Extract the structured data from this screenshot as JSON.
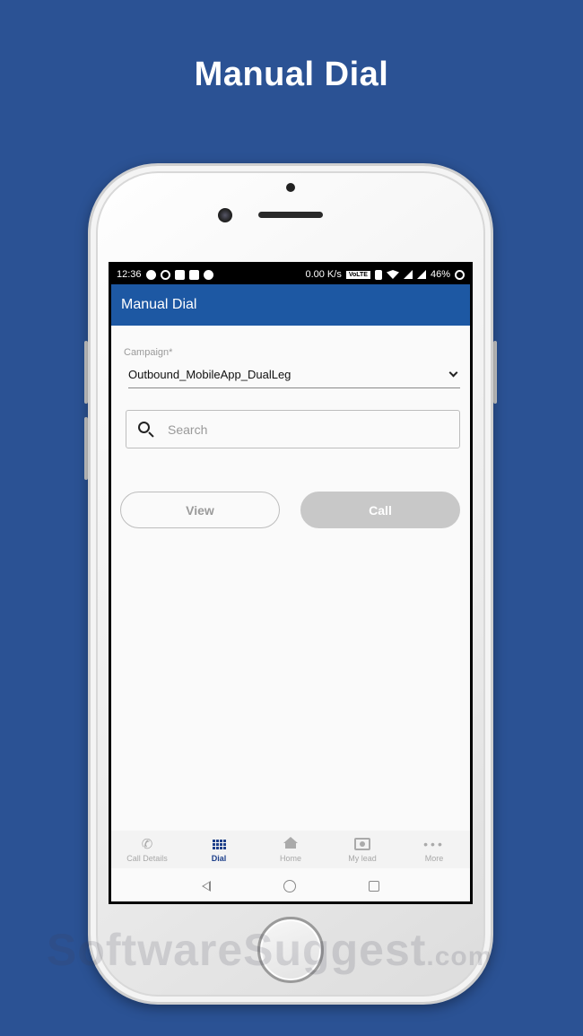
{
  "headline": "Manual Dial",
  "status_bar": {
    "time": "12:36",
    "speed": "0.00 K/s",
    "volte": "VoLTE",
    "battery": "46%"
  },
  "app_bar": {
    "title": "Manual Dial"
  },
  "campaign": {
    "label": "Campaign*",
    "selected": "Outbound_MobileApp_DualLeg"
  },
  "search": {
    "placeholder": "Search"
  },
  "buttons": {
    "view": "View",
    "call": "Call"
  },
  "bottom_nav": {
    "items": [
      {
        "label": "Call Details"
      },
      {
        "label": "Dial"
      },
      {
        "label": "Home"
      },
      {
        "label": "My lead"
      },
      {
        "label": "More"
      }
    ],
    "active": "Dial"
  },
  "watermark": {
    "brand": "SoftwareSuggest",
    "suffix": ".com"
  },
  "colors": {
    "background": "#2b5294",
    "app_bar": "#1d58a3",
    "active_nav": "#1d3f8a",
    "call_button": "#c8c8c8"
  }
}
